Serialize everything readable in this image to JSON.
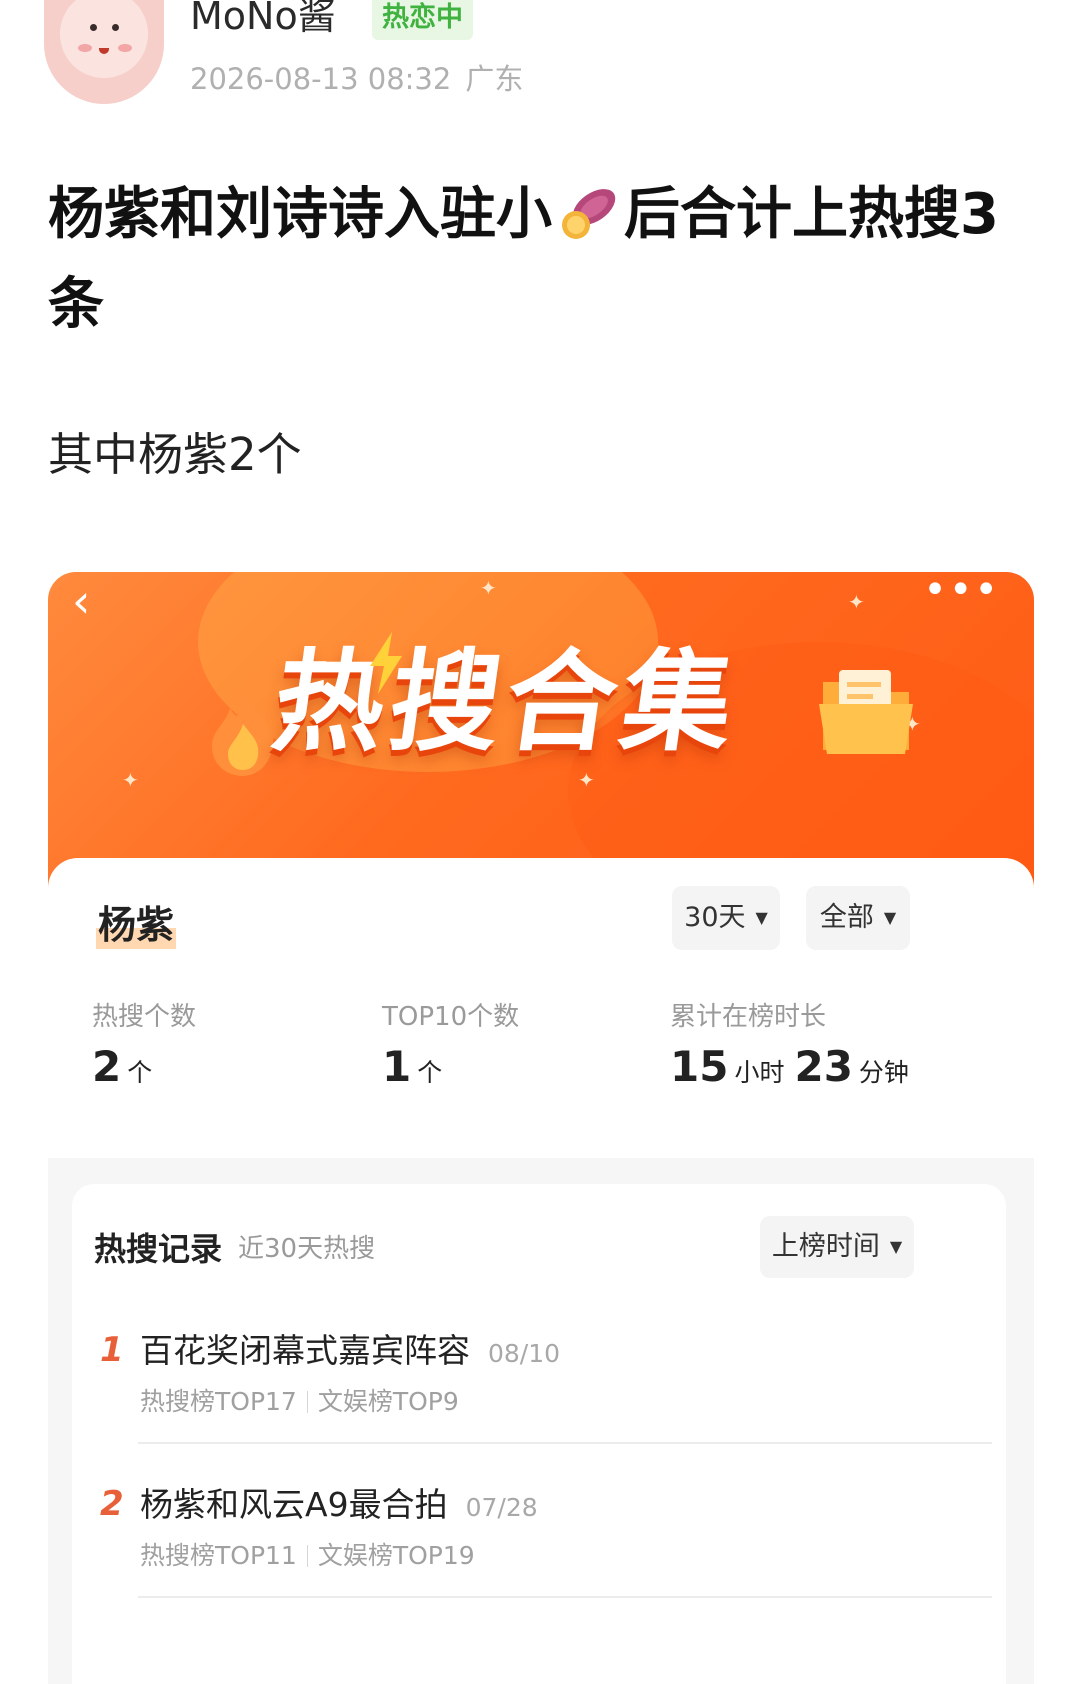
{
  "post": {
    "username": "MoNo酱",
    "hot_tag": "热恋中",
    "timestamp": "2026-08-13 08:32",
    "location": "广东",
    "title_part1": "杨紫和刘诗诗入驻小",
    "title_part2": "后合计上热搜3条",
    "title_icon": "sweet-potato-icon",
    "body": "其中杨紫2个"
  },
  "screenshot": {
    "banner": {
      "heading": "热搜合集",
      "back_icon": "back-chevron-icon",
      "more_icon": "more-dots-icon"
    },
    "person": "杨紫",
    "range_filter": "30天",
    "type_filter": "全部",
    "stats": [
      {
        "label": "热搜个数",
        "value": "2",
        "unit": "个"
      },
      {
        "label": "TOP10个数",
        "value": "1",
        "unit": "个"
      },
      {
        "label": "累计在榜时长",
        "hours": "15",
        "hours_unit": "小时",
        "minutes": "23",
        "minutes_unit": "分钟"
      }
    ],
    "records": {
      "title": "热搜记录",
      "subtitle": "近30天热搜",
      "sort_label": "上榜时间",
      "items": [
        {
          "rank": "1",
          "title": "百花奖闭幕式嘉宾阵容",
          "date": "08/10",
          "board1": "热搜榜TOP17",
          "board2": "文娱榜TOP9"
        },
        {
          "rank": "2",
          "title": "杨紫和风云A9最合拍",
          "date": "07/28",
          "board1": "热搜榜TOP11",
          "board2": "文娱榜TOP19"
        }
      ]
    }
  },
  "colors": {
    "accent_orange": "#ff6a1f",
    "hot_tag_green": "#3fb23f",
    "rank_red": "#e8603a"
  }
}
